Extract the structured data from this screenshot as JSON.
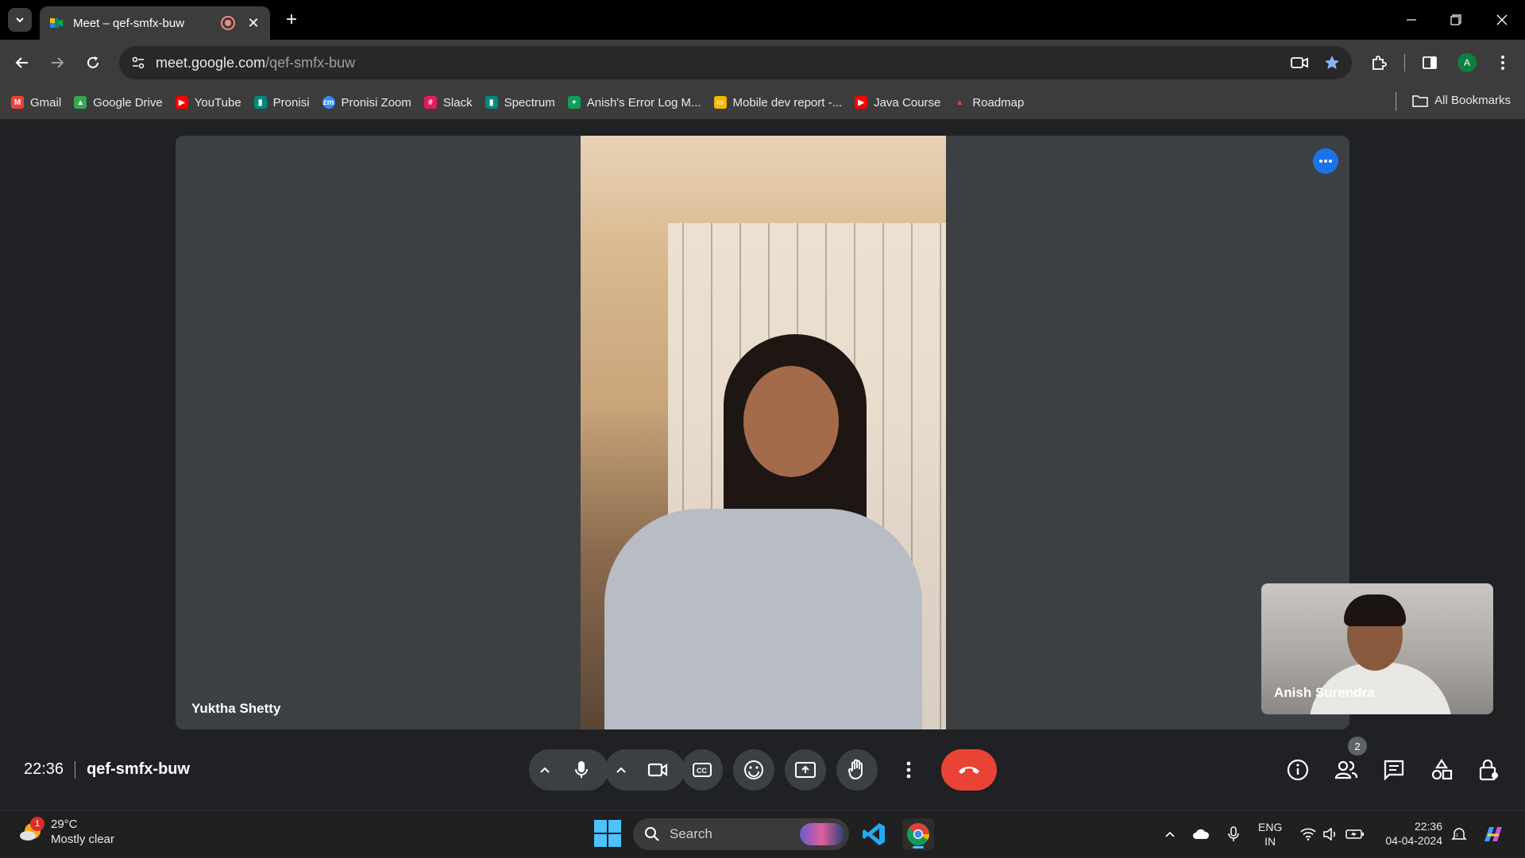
{
  "browser": {
    "tab_title": "Meet – qef-smfx-buw",
    "url_host": "meet.google.com",
    "url_path": "/qef-smfx-buw",
    "profile_initial": "A",
    "bookmarks": [
      {
        "label": "Gmail",
        "icon": "gmail-icon",
        "color": "#ea4335"
      },
      {
        "label": "Google Drive",
        "icon": "drive-icon",
        "color": "#34a853"
      },
      {
        "label": "YouTube",
        "icon": "youtube-icon",
        "color": "#ff0000"
      },
      {
        "label": "Pronisi",
        "icon": "meet-icon",
        "color": "#00897b"
      },
      {
        "label": "Pronisi Zoom",
        "icon": "zoom-icon",
        "color": "#2d8cff"
      },
      {
        "label": "Slack",
        "icon": "slack-icon",
        "color": "#e01e5a"
      },
      {
        "label": "Spectrum",
        "icon": "meet-icon",
        "color": "#00897b"
      },
      {
        "label": "Anish's Error Log M...",
        "icon": "sheets-icon",
        "color": "#0f9d58"
      },
      {
        "label": "Mobile dev report -...",
        "icon": "slides-icon",
        "color": "#f4b400"
      },
      {
        "label": "Java Course",
        "icon": "youtube-icon",
        "color": "#ff0000"
      },
      {
        "label": "Roadmap",
        "icon": "rocket-icon",
        "color": "#ea4335"
      }
    ],
    "all_bookmarks": "All Bookmarks"
  },
  "meet": {
    "main_participant": "Yuktha Shetty",
    "self_participant": "Anish Surendra",
    "time": "22:36",
    "meeting_code": "qef-smfx-buw",
    "people_count": "2",
    "end_call_color": "#ea4335",
    "accent_color": "#1a73e8"
  },
  "taskbar": {
    "weather_temp": "29°C",
    "weather_desc": "Mostly clear",
    "weather_badge": "1",
    "search_label": "Search",
    "lang_top": "ENG",
    "lang_bottom": "IN",
    "time": "22:36",
    "date": "04-04-2024"
  }
}
